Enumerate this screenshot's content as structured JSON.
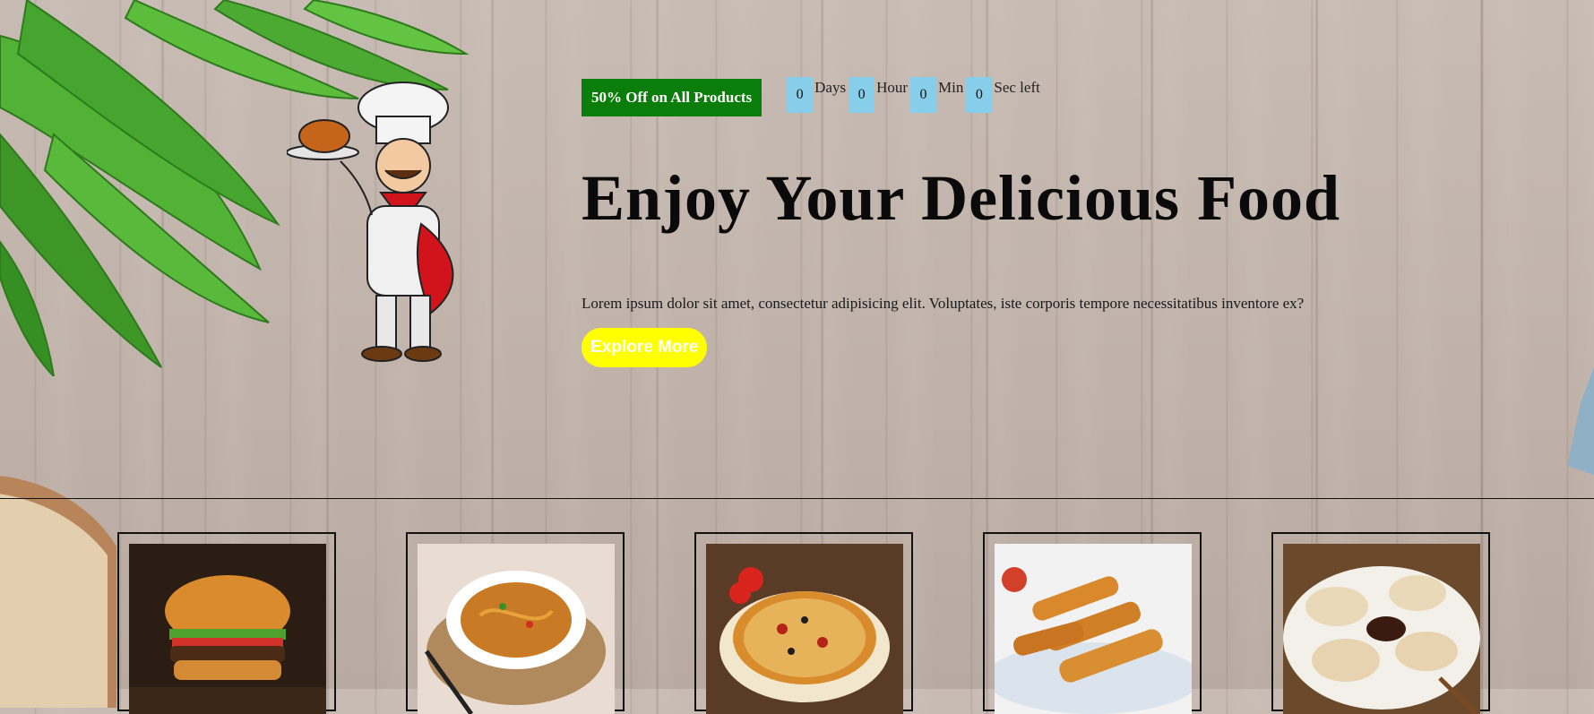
{
  "hero": {
    "offer_label": "50% Off on All Products",
    "countdown": [
      {
        "value": "0",
        "unit": "Days"
      },
      {
        "value": "0",
        "unit": "Hour"
      },
      {
        "value": "0",
        "unit": "Min"
      },
      {
        "value": "0",
        "unit": "Sec left"
      }
    ],
    "headline": "Enjoy Your Delicious Food",
    "description": "Lorem ipsum dolor sit amet, consectetur adipisicing elit. Voluptates, iste corporis tempore necessitatibus inventore ex?",
    "cta_label": "Explore More"
  },
  "colors": {
    "offer_badge": "#0a7d0a",
    "countdown_box": "#87ceeb",
    "cta": "#ffff00"
  },
  "products": [
    {
      "name": "burger",
      "icon": "burger-image"
    },
    {
      "name": "noodles",
      "icon": "noodles-image"
    },
    {
      "name": "pizza",
      "icon": "pizza-image"
    },
    {
      "name": "spring rolls",
      "icon": "spring-rolls-image"
    },
    {
      "name": "dumplings",
      "icon": "dumplings-image"
    }
  ]
}
